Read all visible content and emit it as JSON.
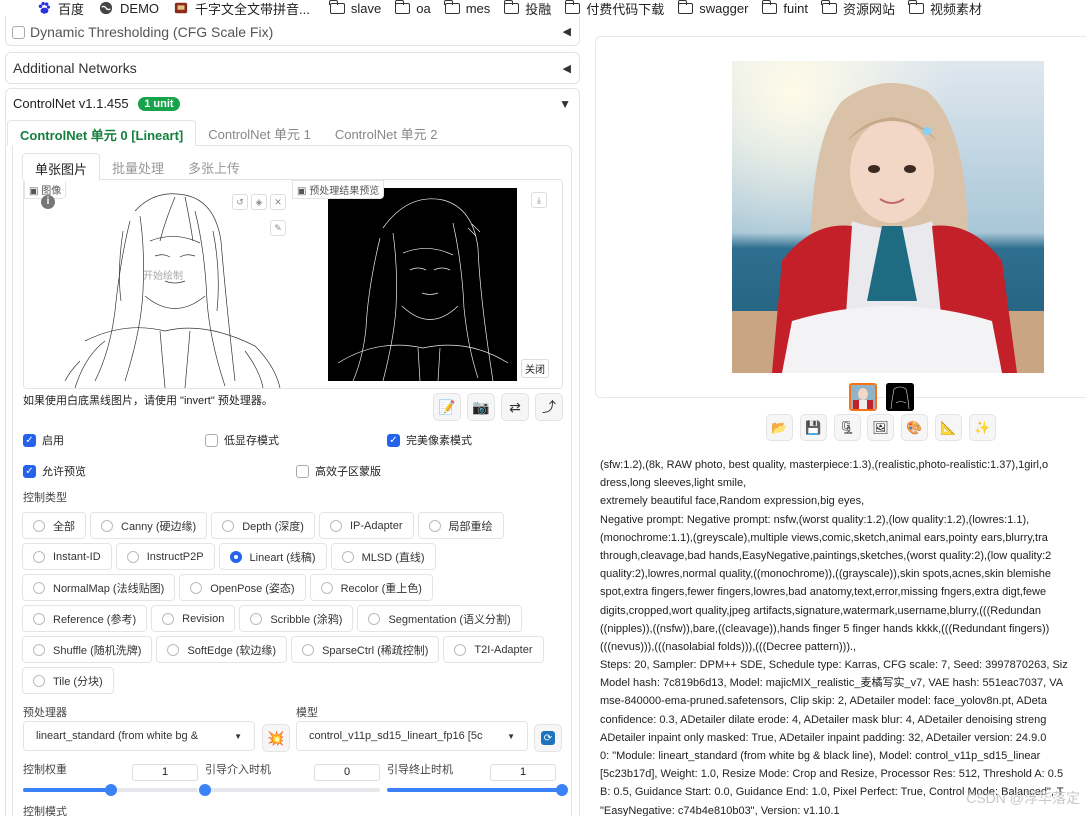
{
  "bookmarks": [
    {
      "label": "百度",
      "icon": "baidu-paw-icon"
    },
    {
      "label": "DEMO",
      "icon": "globe-icon"
    },
    {
      "label": "千字文全文带拼音...",
      "icon": "book-site-icon"
    },
    {
      "label": "slave",
      "icon": "folder-icon"
    },
    {
      "label": "oa",
      "icon": "folder-icon"
    },
    {
      "label": "mes",
      "icon": "folder-icon"
    },
    {
      "label": "投融",
      "icon": "folder-icon"
    },
    {
      "label": "付费代码下载",
      "icon": "folder-icon"
    },
    {
      "label": "swagger",
      "icon": "folder-icon"
    },
    {
      "label": "fuint",
      "icon": "folder-icon"
    },
    {
      "label": "资源网站",
      "icon": "folder-icon"
    },
    {
      "label": "视频素材",
      "icon": "folder-icon"
    }
  ],
  "left": {
    "dynamic_thresholding": "Dynamic Thresholding (CFG Scale Fix)",
    "additional_networks": "Additional Networks",
    "controlnet_title": "ControlNet v1.1.455",
    "controlnet_badge": "1 unit",
    "unit_tabs": [
      "ControlNet 单元 0 [Lineart]",
      "ControlNet 单元 1",
      "ControlNet 单元 2"
    ],
    "image_tabs": [
      "单张图片",
      "批量处理",
      "多张上传"
    ],
    "image_label": "图像",
    "start_drawing": "开始绘制",
    "preview_label": "预处理结果预览",
    "close_label": "关闭",
    "hint": "如果使用白底黑线图片，请使用 \"invert\" 预处理器。",
    "checkboxes": {
      "enable": {
        "label": "启用",
        "checked": true
      },
      "low_vram": {
        "label": "低显存模式",
        "checked": false
      },
      "pixel_perfect": {
        "label": "完美像素模式",
        "checked": true
      },
      "allow_preview": {
        "label": "允许预览",
        "checked": true
      },
      "efficient_mask": {
        "label": "高效子区蒙版",
        "checked": false
      }
    },
    "control_type_label": "控制类型",
    "control_types": [
      [
        "全部",
        "Canny (硬边缘)",
        "Depth (深度)",
        "IP-Adapter",
        "局部重绘"
      ],
      [
        "Instant-ID",
        "InstructP2P",
        "Lineart (线稿)",
        "MLSD (直线)"
      ],
      [
        "NormalMap (法线贴图)",
        "OpenPose (姿态)",
        "Recolor (重上色)"
      ],
      [
        "Reference (参考)",
        "Revision",
        "Scribble (涂鸦)",
        "Segmentation (语义分割)"
      ],
      [
        "Shuffle (随机洗牌)",
        "SoftEdge (软边缘)",
        "SparseCtrl (稀疏控制)",
        "T2I-Adapter"
      ],
      [
        "Tile (分块)"
      ]
    ],
    "selected_control_type": "Lineart (线稿)",
    "preprocessor_label": "预处理器",
    "preprocessor_value": "lineart_standard (from white bg &",
    "model_label": "模型",
    "model_value": "control_v11p_sd15_lineart_fp16 [5c",
    "weight_label": "控制权重",
    "weight_value": "1",
    "start_label": "引导介入时机",
    "start_value": "0",
    "end_label": "引导终止时机",
    "end_value": "1",
    "weight_fraction": 0.5,
    "start_fraction": 0,
    "end_fraction": 1,
    "control_mode_label": "控制模式"
  },
  "right": {
    "info_lines": [
      "(sfw:1.2),(8k, RAW photo, best quality, masterpiece:1.3),(realistic,photo-realistic:1.37),1girl,o",
      "dress,long sleeves,light smile,",
      "extremely beautiful face,Random expression,big eyes,",
      "Negative prompt: Negative prompt: nsfw,(worst quality:1.2),(low quality:1.2),(lowres:1.1),",
      "(monochrome:1.1),(greyscale),multiple views,comic,sketch,animal ears,pointy ears,blurry,tra",
      "through,cleavage,bad hands,EasyNegative,paintings,sketches,(worst quality:2),(low quality:2",
      "quality:2),lowres,normal quality,((monochrome)),((grayscale)),skin spots,acnes,skin blemishe",
      "spot,extra fingers,fewer fingers,lowres,bad anatomy,text,error,missing fngers,extra digt,fewe",
      "digits,cropped,wort quality,jpeg artifacts,signature,watermark,username,blurry,(((Redundan",
      "((nipples)),((nsfw)),bare,((cleavage)),hands finger 5 finger hands kkkk,(((Redundant fingers))",
      "(((nevus))),(((nasolabial folds))),(((Decree pattern))).,",
      "Steps: 20, Sampler: DPM++ SDE, Schedule type: Karras, CFG scale: 7, Seed: 3997870263, Siz",
      "Model hash: 7c819b6d13, Model: majicMIX_realistic_麦橘写实_v7, VAE hash: 551eac7037, VA",
      "mse-840000-ema-pruned.safetensors, Clip skip: 2, ADetailer model: face_yolov8n.pt, ADeta",
      "confidence: 0.3, ADetailer dilate erode: 4, ADetailer mask blur: 4, ADetailer denoising streng",
      "ADetailer inpaint only masked: True, ADetailer inpaint padding: 32, ADetailer version: 24.9.0",
      "0: \"Module: lineart_standard (from white bg & black line), Model: control_v11p_sd15_linear",
      "[5c23b17d], Weight: 1.0, Resize Mode: Crop and Resize, Processor Res: 512, Threshold A: 0.5",
      "B: 0.5, Guidance Start: 0.0, Guidance End: 1.0, Pixel Perfect: True, Control Mode: Balanced\", T",
      "\"EasyNegative: c74b4e810b03\", Version: v1.10.1"
    ],
    "watermark": "CSDN @浮华落定"
  }
}
